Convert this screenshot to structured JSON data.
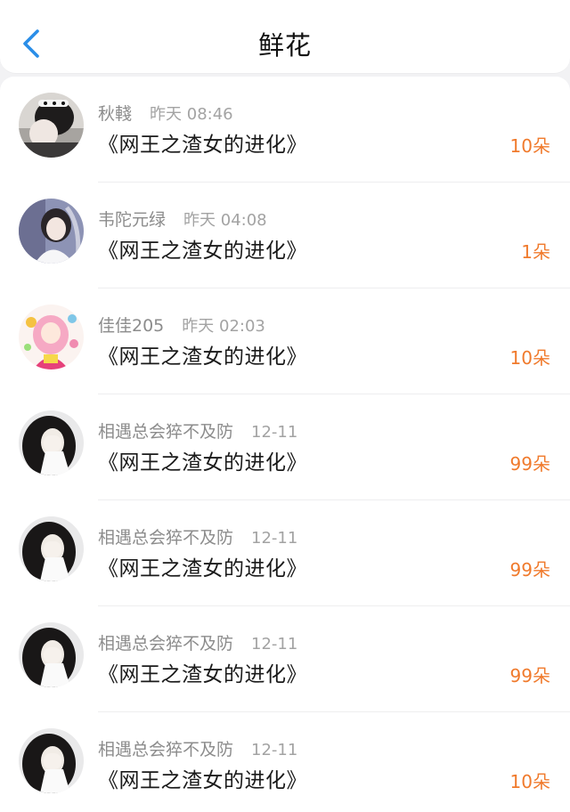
{
  "header": {
    "title": "鲜花"
  },
  "colors": {
    "accent_blue": "#2a8ee8",
    "count_orange": "#f07a2c"
  },
  "rows": [
    {
      "avatar_icon": "avatar-photo-girl-hairband",
      "user": "秋輚",
      "time": "昨天 08:46",
      "book": "《网王之渣女的进化》",
      "count": "10朵"
    },
    {
      "avatar_icon": "avatar-photo-girl-bridal",
      "user": "韦陀元绿",
      "time": "昨天 04:08",
      "book": "《网王之渣女的进化》",
      "count": "1朵"
    },
    {
      "avatar_icon": "avatar-anime-girl-pink",
      "user": "佳佳205",
      "time": "昨天 02:03",
      "book": "《网王之渣女的进化》",
      "count": "10朵"
    },
    {
      "avatar_icon": "avatar-photo-girl-covering-face",
      "user": "相遇总会猝不及防",
      "time": "12-11",
      "book": "《网王之渣女的进化》",
      "count": "99朵"
    },
    {
      "avatar_icon": "avatar-photo-girl-covering-face",
      "user": "相遇总会猝不及防",
      "time": "12-11",
      "book": "《网王之渣女的进化》",
      "count": "99朵"
    },
    {
      "avatar_icon": "avatar-photo-girl-covering-face",
      "user": "相遇总会猝不及防",
      "time": "12-11",
      "book": "《网王之渣女的进化》",
      "count": "99朵"
    },
    {
      "avatar_icon": "avatar-photo-girl-covering-face",
      "user": "相遇总会猝不及防",
      "time": "12-11",
      "book": "《网王之渣女的进化》",
      "count": "10朵"
    }
  ]
}
